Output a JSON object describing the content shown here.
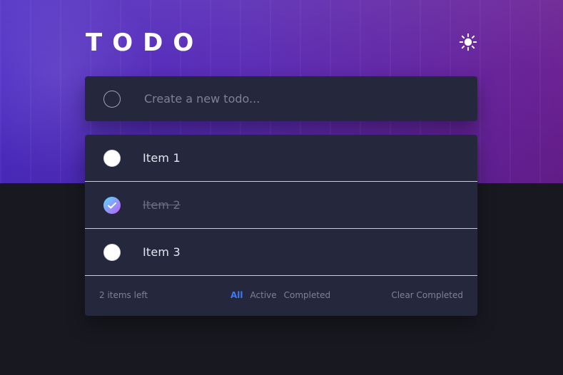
{
  "header": {
    "title": "TODO",
    "theme_toggle_icon": "sun-icon"
  },
  "new_todo": {
    "placeholder": "Create a new todo...",
    "value": ""
  },
  "todos": [
    {
      "label": "Item 1",
      "completed": false
    },
    {
      "label": "Item 2",
      "completed": true
    },
    {
      "label": "Item 3",
      "completed": false
    }
  ],
  "footer": {
    "items_left": "2 items left",
    "filters": [
      {
        "label": "All",
        "active": true
      },
      {
        "label": "Active",
        "active": false
      },
      {
        "label": "Completed",
        "active": false
      }
    ],
    "clear_completed": "Clear Completed"
  },
  "colors": {
    "accent_blue": "#3a7bfd",
    "check_gradient_start": "#57ddff",
    "check_gradient_end": "#c058f3",
    "panel_bg": "#25273d",
    "page_bg": "#181820"
  }
}
